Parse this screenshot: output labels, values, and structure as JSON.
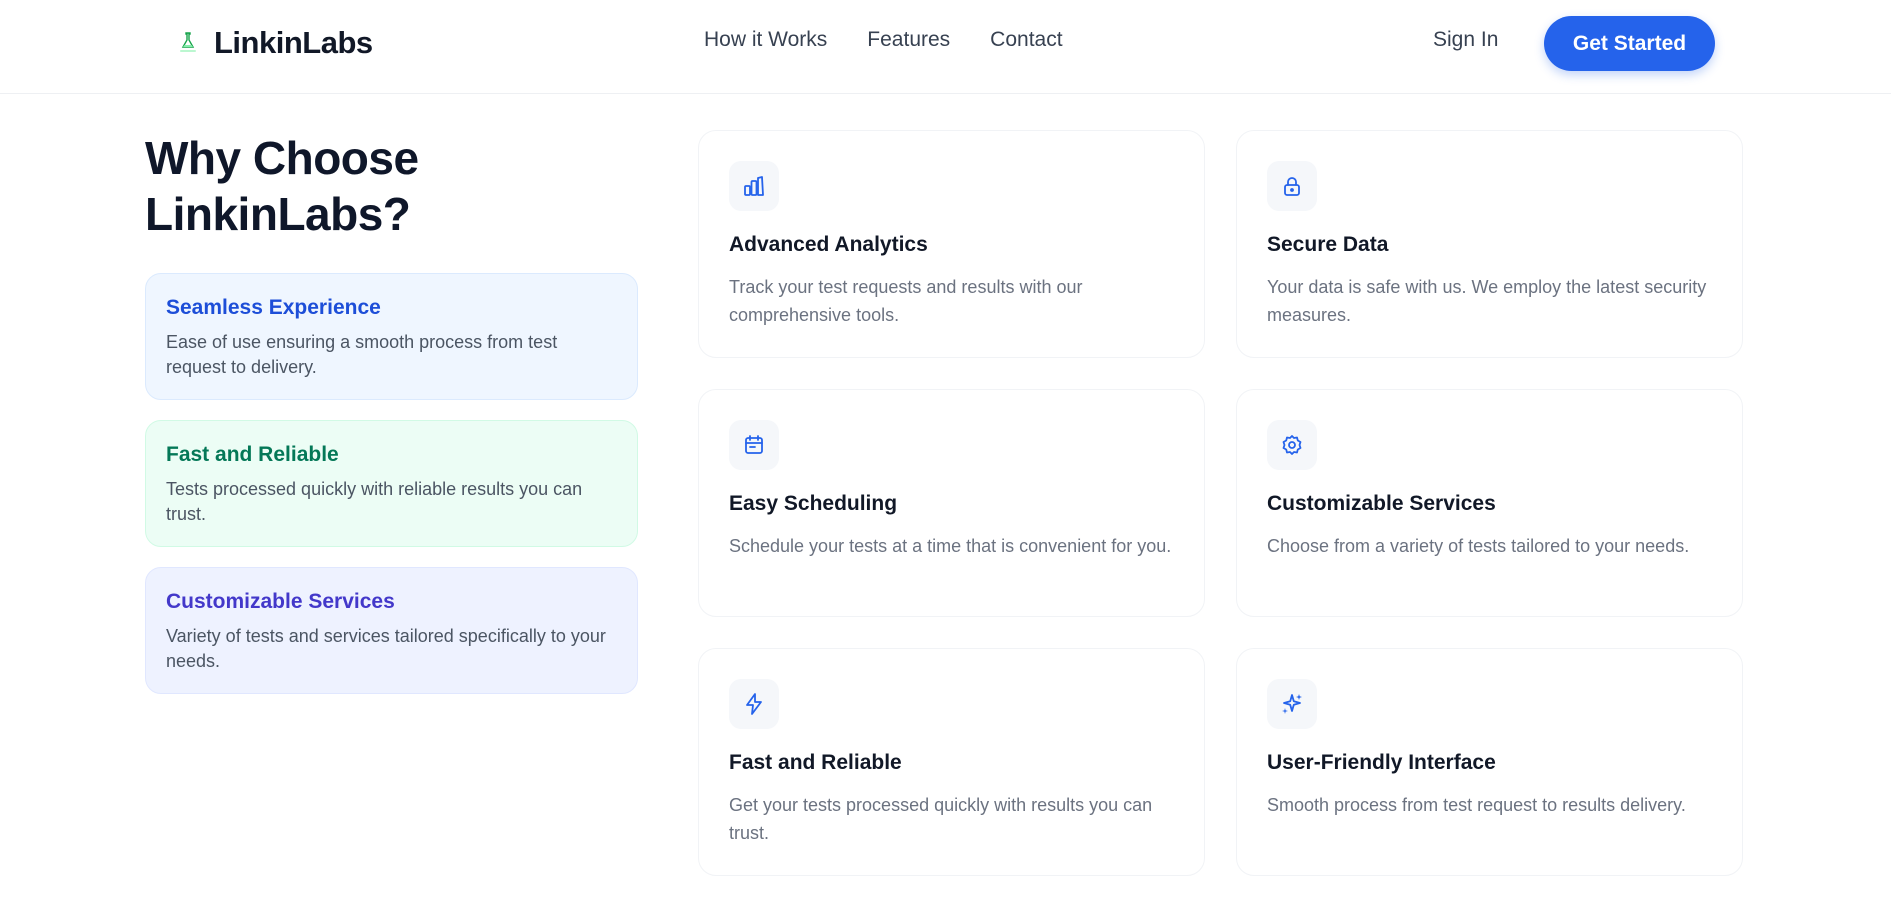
{
  "colors": {
    "primary": "#2563eb",
    "heading": "#0f172a",
    "blue_card_bg": "#eff6ff",
    "green_card_bg": "#ecfdf5",
    "indigo_card_bg": "#eef2ff"
  },
  "header": {
    "logo_icon": "lab-logo-icon",
    "brand": "LinkinLabs",
    "nav": [
      "How it Works",
      "Features",
      "Contact"
    ],
    "sign_in": "Sign In",
    "cta": "Get Started"
  },
  "section": {
    "title": "Why Choose LinkinLabs?",
    "benefits": [
      {
        "title": "Seamless Experience",
        "text": "Ease of use ensuring a smooth process from test request to delivery."
      },
      {
        "title": "Fast and Reliable",
        "text": "Tests processed quickly with reliable results you can trust."
      },
      {
        "title": "Customizable Services",
        "text": "Variety of tests and services tailored specifically to your needs."
      }
    ],
    "features": [
      {
        "icon": "analytics-icon",
        "title": "Advanced Analytics",
        "text": "Track your test requests and results with our comprehensive tools."
      },
      {
        "icon": "lock-icon",
        "title": "Secure Data",
        "text": "Your data is safe with us. We employ the latest security measures."
      },
      {
        "icon": "calendar-icon",
        "title": "Easy Scheduling",
        "text": "Schedule your tests at a time that is convenient for you."
      },
      {
        "icon": "gear-icon",
        "title": "Customizable Services",
        "text": "Choose from a variety of tests tailored to your needs."
      },
      {
        "icon": "lightning-icon",
        "title": "Fast and Reliable",
        "text": "Get your tests processed quickly with results you can trust."
      },
      {
        "icon": "sparkles-icon",
        "title": "User-Friendly Interface",
        "text": "Smooth process from test request to results delivery."
      }
    ]
  }
}
